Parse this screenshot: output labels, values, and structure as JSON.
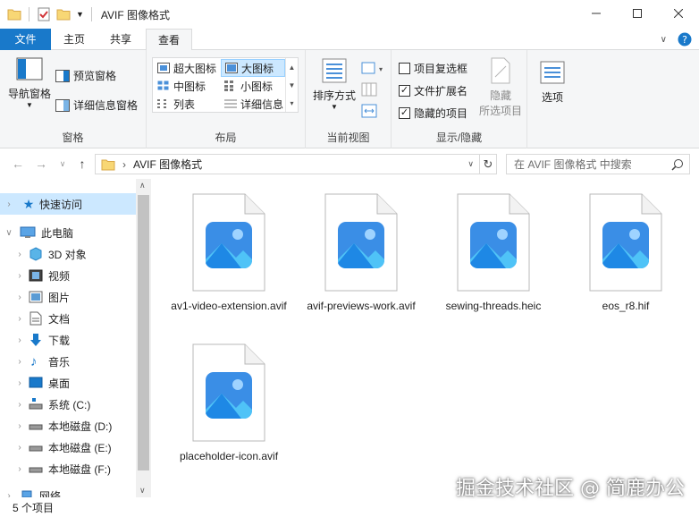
{
  "window": {
    "title": "AVIF 图像格式"
  },
  "tabs": {
    "file": "文件",
    "home": "主页",
    "share": "共享",
    "view": "查看"
  },
  "ribbon": {
    "panes": {
      "nav_pane": "导航窗格",
      "preview_pane": "预览窗格",
      "details_pane": "详细信息窗格",
      "label": "窗格"
    },
    "layout": {
      "extra_large": "超大图标",
      "large": "大图标",
      "medium": "中图标",
      "small": "小图标",
      "list": "列表",
      "details": "详细信息",
      "label": "布局"
    },
    "current_view": {
      "sort_by": "排序方式",
      "label": "当前视图"
    },
    "show_hide": {
      "item_checkboxes": "项目复选框",
      "file_extensions": "文件扩展名",
      "hidden_items": "隐藏的项目",
      "hide_selected_line1": "隐藏",
      "hide_selected_line2": "所选项目",
      "label": "显示/隐藏"
    },
    "options": "选项"
  },
  "address": {
    "path": "AVIF 图像格式",
    "search_placeholder": "在 AVIF 图像格式 中搜索"
  },
  "nav": {
    "items": [
      {
        "label": "快速访问",
        "icon": "star-icon"
      },
      {
        "label": "此电脑",
        "icon": "computer-icon"
      },
      {
        "label": "3D 对象",
        "icon": "cube-icon"
      },
      {
        "label": "视频",
        "icon": "video-icon"
      },
      {
        "label": "图片",
        "icon": "picture-icon"
      },
      {
        "label": "文档",
        "icon": "document-icon"
      },
      {
        "label": "下载",
        "icon": "download-icon"
      },
      {
        "label": "音乐",
        "icon": "music-icon"
      },
      {
        "label": "桌面",
        "icon": "desktop-icon"
      },
      {
        "label": "系统 (C:)",
        "icon": "system-drive-icon"
      },
      {
        "label": "本地磁盘 (D:)",
        "icon": "drive-icon"
      },
      {
        "label": "本地磁盘 (E:)",
        "icon": "drive-icon"
      },
      {
        "label": "本地磁盘 (F:)",
        "icon": "drive-icon"
      },
      {
        "label": "网络",
        "icon": "network-icon"
      }
    ]
  },
  "files": [
    {
      "name": "av1-video-extension.avif"
    },
    {
      "name": "avif-previews-work.avif"
    },
    {
      "name": "sewing-threads.heic"
    },
    {
      "name": "eos_r8.hif"
    },
    {
      "name": "placeholder-icon.avif"
    }
  ],
  "status": {
    "count": "5 个项目"
  },
  "watermark": "掘金技术社区 @ 简鹿办公",
  "colors": {
    "accent": "#1979ca",
    "selection": "#cce8ff"
  }
}
